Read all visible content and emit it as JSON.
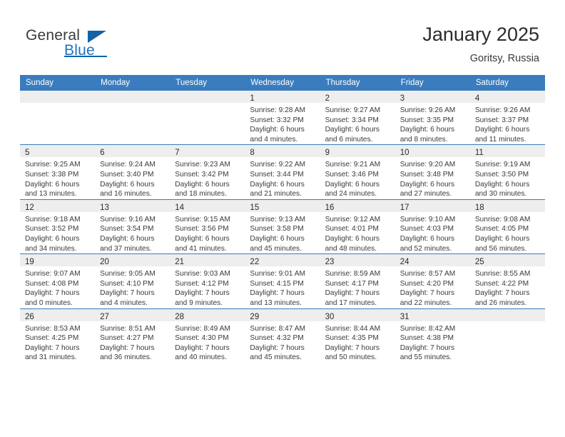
{
  "brand": {
    "name_part1": "General",
    "name_part2": "Blue",
    "triangle_icon": "triangle-icon",
    "accent_color": "#1464a5"
  },
  "header": {
    "title": "January 2025",
    "location": "Goritsy, Russia"
  },
  "theme": {
    "header_row_bg": "#3a7cbe",
    "day_band_bg": "#eeeeee",
    "grid_line": "#3a7cbe",
    "text": "#3a3a3a"
  },
  "calendar": {
    "weekday_headers": [
      "Sunday",
      "Monday",
      "Tuesday",
      "Wednesday",
      "Thursday",
      "Friday",
      "Saturday"
    ],
    "weeks": [
      [
        {
          "day": "",
          "lines": []
        },
        {
          "day": "",
          "lines": []
        },
        {
          "day": "",
          "lines": []
        },
        {
          "day": "1",
          "lines": [
            "Sunrise: 9:28 AM",
            "Sunset: 3:32 PM",
            "Daylight: 6 hours",
            "and 4 minutes."
          ]
        },
        {
          "day": "2",
          "lines": [
            "Sunrise: 9:27 AM",
            "Sunset: 3:34 PM",
            "Daylight: 6 hours",
            "and 6 minutes."
          ]
        },
        {
          "day": "3",
          "lines": [
            "Sunrise: 9:26 AM",
            "Sunset: 3:35 PM",
            "Daylight: 6 hours",
            "and 8 minutes."
          ]
        },
        {
          "day": "4",
          "lines": [
            "Sunrise: 9:26 AM",
            "Sunset: 3:37 PM",
            "Daylight: 6 hours",
            "and 11 minutes."
          ]
        }
      ],
      [
        {
          "day": "5",
          "lines": [
            "Sunrise: 9:25 AM",
            "Sunset: 3:38 PM",
            "Daylight: 6 hours",
            "and 13 minutes."
          ]
        },
        {
          "day": "6",
          "lines": [
            "Sunrise: 9:24 AM",
            "Sunset: 3:40 PM",
            "Daylight: 6 hours",
            "and 16 minutes."
          ]
        },
        {
          "day": "7",
          "lines": [
            "Sunrise: 9:23 AM",
            "Sunset: 3:42 PM",
            "Daylight: 6 hours",
            "and 18 minutes."
          ]
        },
        {
          "day": "8",
          "lines": [
            "Sunrise: 9:22 AM",
            "Sunset: 3:44 PM",
            "Daylight: 6 hours",
            "and 21 minutes."
          ]
        },
        {
          "day": "9",
          "lines": [
            "Sunrise: 9:21 AM",
            "Sunset: 3:46 PM",
            "Daylight: 6 hours",
            "and 24 minutes."
          ]
        },
        {
          "day": "10",
          "lines": [
            "Sunrise: 9:20 AM",
            "Sunset: 3:48 PM",
            "Daylight: 6 hours",
            "and 27 minutes."
          ]
        },
        {
          "day": "11",
          "lines": [
            "Sunrise: 9:19 AM",
            "Sunset: 3:50 PM",
            "Daylight: 6 hours",
            "and 30 minutes."
          ]
        }
      ],
      [
        {
          "day": "12",
          "lines": [
            "Sunrise: 9:18 AM",
            "Sunset: 3:52 PM",
            "Daylight: 6 hours",
            "and 34 minutes."
          ]
        },
        {
          "day": "13",
          "lines": [
            "Sunrise: 9:16 AM",
            "Sunset: 3:54 PM",
            "Daylight: 6 hours",
            "and 37 minutes."
          ]
        },
        {
          "day": "14",
          "lines": [
            "Sunrise: 9:15 AM",
            "Sunset: 3:56 PM",
            "Daylight: 6 hours",
            "and 41 minutes."
          ]
        },
        {
          "day": "15",
          "lines": [
            "Sunrise: 9:13 AM",
            "Sunset: 3:58 PM",
            "Daylight: 6 hours",
            "and 45 minutes."
          ]
        },
        {
          "day": "16",
          "lines": [
            "Sunrise: 9:12 AM",
            "Sunset: 4:01 PM",
            "Daylight: 6 hours",
            "and 48 minutes."
          ]
        },
        {
          "day": "17",
          "lines": [
            "Sunrise: 9:10 AM",
            "Sunset: 4:03 PM",
            "Daylight: 6 hours",
            "and 52 minutes."
          ]
        },
        {
          "day": "18",
          "lines": [
            "Sunrise: 9:08 AM",
            "Sunset: 4:05 PM",
            "Daylight: 6 hours",
            "and 56 minutes."
          ]
        }
      ],
      [
        {
          "day": "19",
          "lines": [
            "Sunrise: 9:07 AM",
            "Sunset: 4:08 PM",
            "Daylight: 7 hours",
            "and 0 minutes."
          ]
        },
        {
          "day": "20",
          "lines": [
            "Sunrise: 9:05 AM",
            "Sunset: 4:10 PM",
            "Daylight: 7 hours",
            "and 4 minutes."
          ]
        },
        {
          "day": "21",
          "lines": [
            "Sunrise: 9:03 AM",
            "Sunset: 4:12 PM",
            "Daylight: 7 hours",
            "and 9 minutes."
          ]
        },
        {
          "day": "22",
          "lines": [
            "Sunrise: 9:01 AM",
            "Sunset: 4:15 PM",
            "Daylight: 7 hours",
            "and 13 minutes."
          ]
        },
        {
          "day": "23",
          "lines": [
            "Sunrise: 8:59 AM",
            "Sunset: 4:17 PM",
            "Daylight: 7 hours",
            "and 17 minutes."
          ]
        },
        {
          "day": "24",
          "lines": [
            "Sunrise: 8:57 AM",
            "Sunset: 4:20 PM",
            "Daylight: 7 hours",
            "and 22 minutes."
          ]
        },
        {
          "day": "25",
          "lines": [
            "Sunrise: 8:55 AM",
            "Sunset: 4:22 PM",
            "Daylight: 7 hours",
            "and 26 minutes."
          ]
        }
      ],
      [
        {
          "day": "26",
          "lines": [
            "Sunrise: 8:53 AM",
            "Sunset: 4:25 PM",
            "Daylight: 7 hours",
            "and 31 minutes."
          ]
        },
        {
          "day": "27",
          "lines": [
            "Sunrise: 8:51 AM",
            "Sunset: 4:27 PM",
            "Daylight: 7 hours",
            "and 36 minutes."
          ]
        },
        {
          "day": "28",
          "lines": [
            "Sunrise: 8:49 AM",
            "Sunset: 4:30 PM",
            "Daylight: 7 hours",
            "and 40 minutes."
          ]
        },
        {
          "day": "29",
          "lines": [
            "Sunrise: 8:47 AM",
            "Sunset: 4:32 PM",
            "Daylight: 7 hours",
            "and 45 minutes."
          ]
        },
        {
          "day": "30",
          "lines": [
            "Sunrise: 8:44 AM",
            "Sunset: 4:35 PM",
            "Daylight: 7 hours",
            "and 50 minutes."
          ]
        },
        {
          "day": "31",
          "lines": [
            "Sunrise: 8:42 AM",
            "Sunset: 4:38 PM",
            "Daylight: 7 hours",
            "and 55 minutes."
          ]
        },
        {
          "day": "",
          "lines": []
        }
      ]
    ]
  }
}
